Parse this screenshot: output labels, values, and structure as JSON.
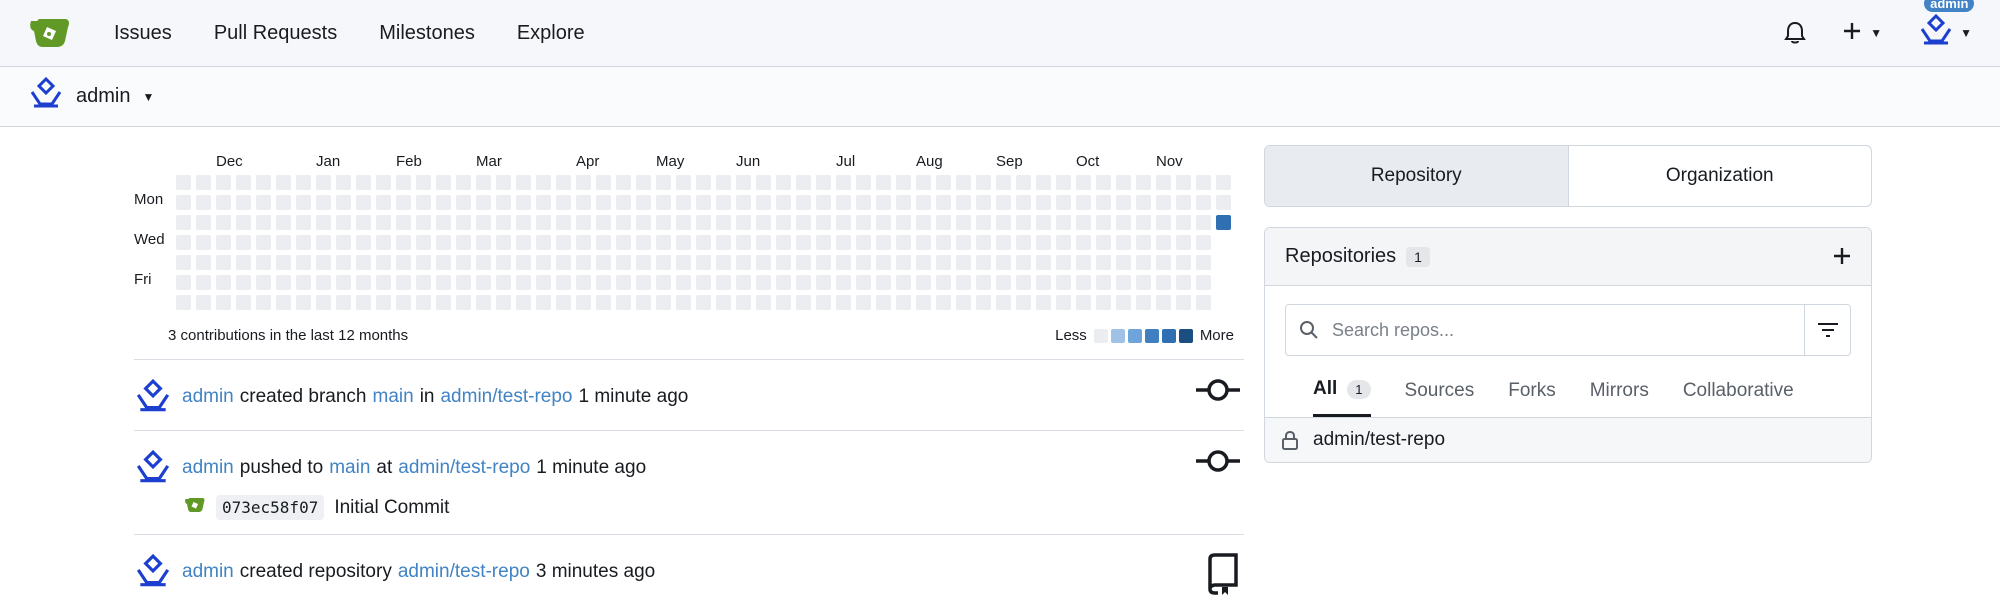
{
  "colors": {
    "accent": "#4183c4",
    "heat_empty": "#ebedf0",
    "heat_levels": [
      "#ebedf0",
      "#9fc1e6",
      "#6ea3db",
      "#3f7fc2",
      "#2f6fb2",
      "#1d4e82"
    ]
  },
  "navbar": {
    "logo_icon": "gitea-logo-icon",
    "items": [
      {
        "label": "Issues"
      },
      {
        "label": "Pull Requests"
      },
      {
        "label": "Milestones"
      },
      {
        "label": "Explore"
      }
    ],
    "notification_icon": "bell-icon",
    "create_icon": "plus-icon",
    "user_badge": "admin"
  },
  "context": {
    "name": "admin"
  },
  "heatmap": {
    "months": [
      "Dec",
      "Jan",
      "Feb",
      "Mar",
      "Apr",
      "May",
      "Jun",
      "Jul",
      "Aug",
      "Sep",
      "Oct",
      "Nov"
    ],
    "days": [
      "Mon",
      "Wed",
      "Fri"
    ],
    "weeks": 53,
    "active_cells": [
      {
        "week": 52,
        "day": 2,
        "level": 4
      }
    ],
    "summary": "3 contributions in the last 12 months",
    "legend_less": "Less",
    "legend_more": "More"
  },
  "feed": [
    {
      "user": "admin",
      "action": "created branch",
      "target": "main",
      "prep": "in",
      "repo": "admin/test-repo",
      "time": "1 minute ago",
      "icon": "git-commit-icon"
    },
    {
      "user": "admin",
      "action": "pushed to",
      "target": "main",
      "prep": "at",
      "repo": "admin/test-repo",
      "time": "1 minute ago",
      "icon": "git-commit-icon",
      "commit": {
        "sha": "073ec58f07",
        "message": "Initial Commit"
      }
    },
    {
      "user": "admin",
      "action": "created repository",
      "repo": "admin/test-repo",
      "time": "3 minutes ago",
      "icon": "repo-icon"
    }
  ],
  "sidebar": {
    "tabs": [
      {
        "label": "Repository"
      },
      {
        "label": "Organization"
      }
    ],
    "repos": {
      "title": "Repositories",
      "count": "1",
      "search_placeholder": "Search repos...",
      "filters": [
        {
          "label": "All",
          "count": "1"
        },
        {
          "label": "Sources"
        },
        {
          "label": "Forks"
        },
        {
          "label": "Mirrors"
        },
        {
          "label": "Collaborative"
        }
      ],
      "items": [
        {
          "name": "admin/test-repo",
          "icon": "lock-icon"
        }
      ]
    }
  }
}
